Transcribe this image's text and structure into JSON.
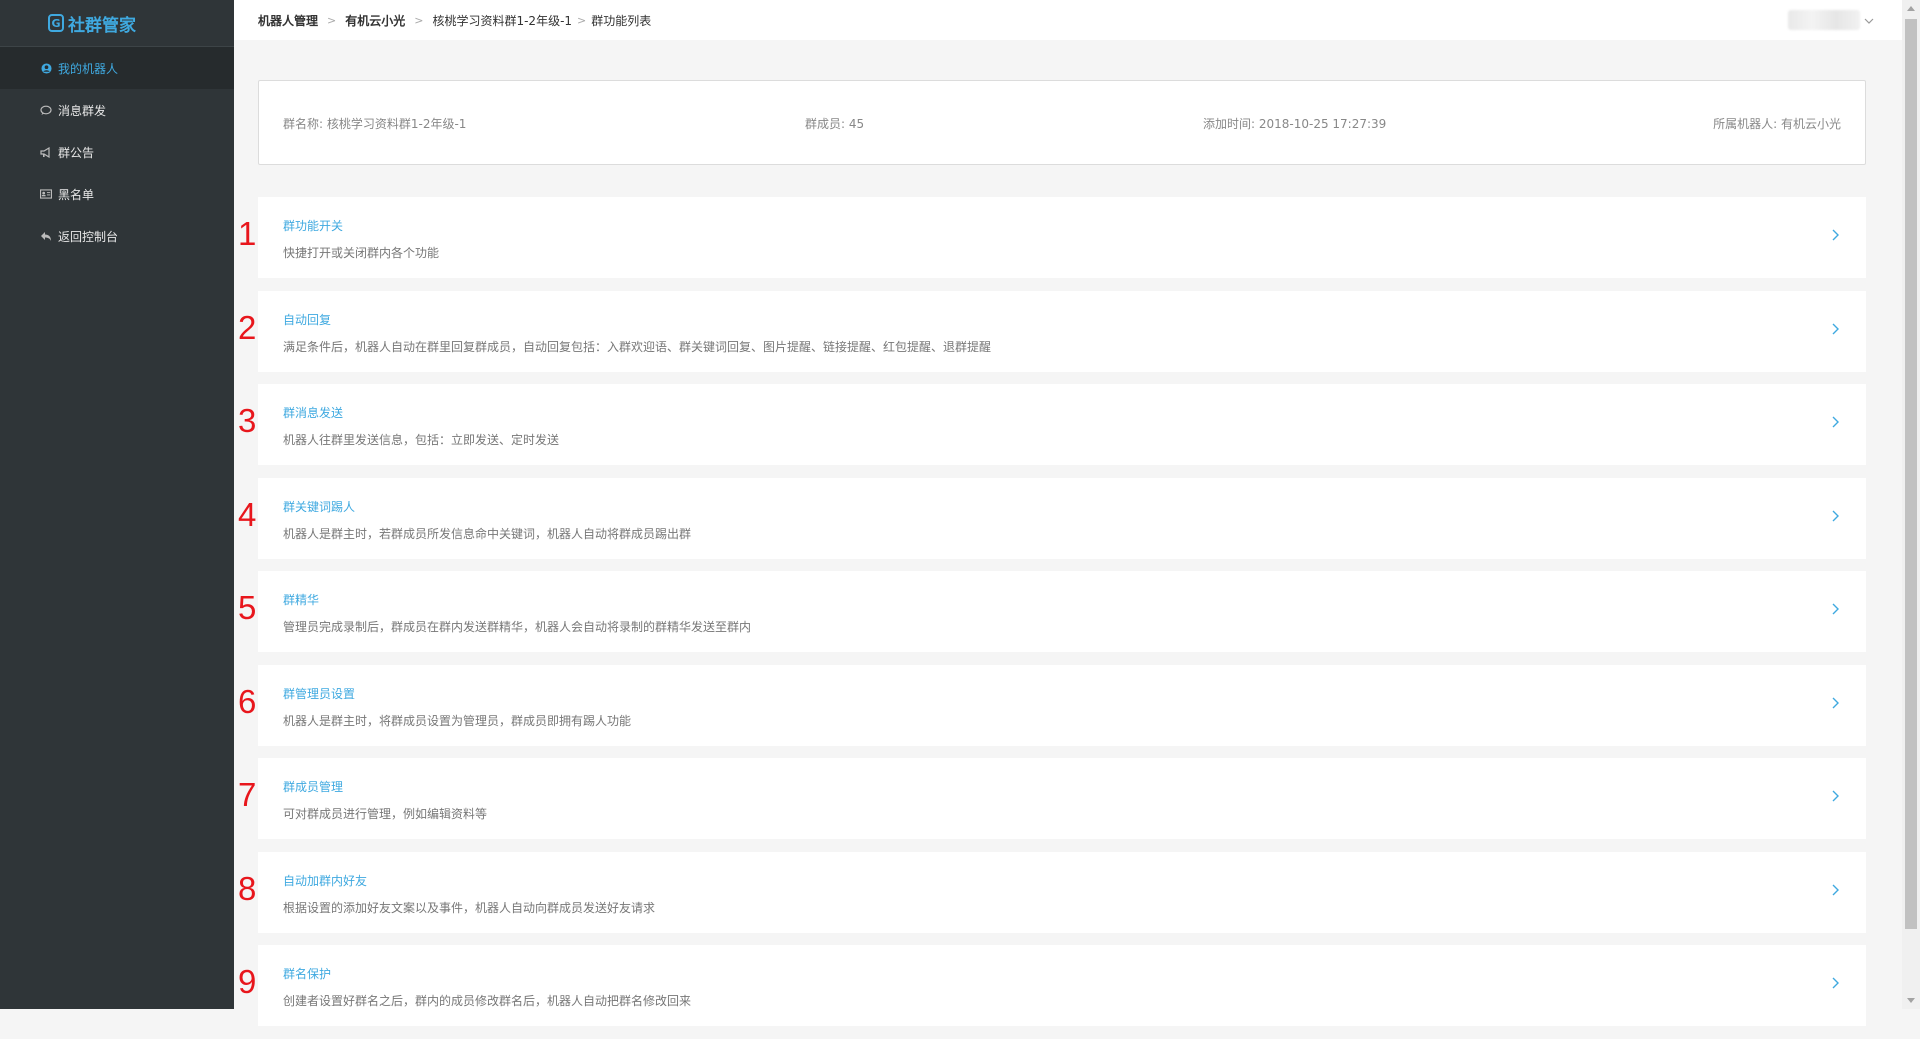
{
  "app": {
    "logo_text": "社群管家",
    "logo_mark": "G"
  },
  "sidebar": {
    "items": [
      {
        "label": "我的机器人",
        "icon": "user-circle-icon",
        "active": true
      },
      {
        "label": "消息群发",
        "icon": "chat-bubble-icon",
        "active": false
      },
      {
        "label": "群公告",
        "icon": "megaphone-icon",
        "active": false
      },
      {
        "label": "黑名单",
        "icon": "id-card-icon",
        "active": false
      },
      {
        "label": "返回控制台",
        "icon": "reply-icon",
        "active": false
      }
    ]
  },
  "breadcrumb": {
    "items": [
      "机器人管理",
      "有机云小光",
      "核桃学习资料群1-2年级-1",
      "群功能列表"
    ],
    "separator": ">"
  },
  "group_info": {
    "name": "群名称: 核桃学习资料群1-2年级-1",
    "members": "群成员: 45",
    "added_time": "添加时间: 2018-10-25 17:27:39",
    "robot": "所属机器人: 有机云小光"
  },
  "features": [
    {
      "num": "1",
      "title": "群功能开关",
      "desc": "快捷打开或关闭群内各个功能"
    },
    {
      "num": "2",
      "title": "自动回复",
      "desc": "满足条件后，机器人自动在群里回复群成员，自动回复包括：入群欢迎语、群关键词回复、图片提醒、链接提醒、红包提醒、退群提醒"
    },
    {
      "num": "3",
      "title": "群消息发送",
      "desc": "机器人往群里发送信息，包括：立即发送、定时发送"
    },
    {
      "num": "4",
      "title": "群关键词踢人",
      "desc": "机器人是群主时，若群成员所发信息命中关键词，机器人自动将群成员踢出群"
    },
    {
      "num": "5",
      "title": "群精华",
      "desc": "管理员完成录制后，群成员在群内发送群精华，机器人会自动将录制的群精华发送至群内"
    },
    {
      "num": "6",
      "title": "群管理员设置",
      "desc": "机器人是群主时，将群成员设置为管理员，群成员即拥有踢人功能"
    },
    {
      "num": "7",
      "title": "群成员管理",
      "desc": "可对群成员进行管理，例如编辑资料等"
    },
    {
      "num": "8",
      "title": "自动加群内好友",
      "desc": "根据设置的添加好友文案以及事件，机器人自动向群成员发送好友请求"
    },
    {
      "num": "9",
      "title": "群名保护",
      "desc": "创建者设置好群名之后，群内的成员修改群名后，机器人自动把群名修改回来"
    }
  ],
  "colors": {
    "accent": "#3fa9e0",
    "sidebar_bg": "#2f3538",
    "annotation_red": "#e8161c"
  }
}
